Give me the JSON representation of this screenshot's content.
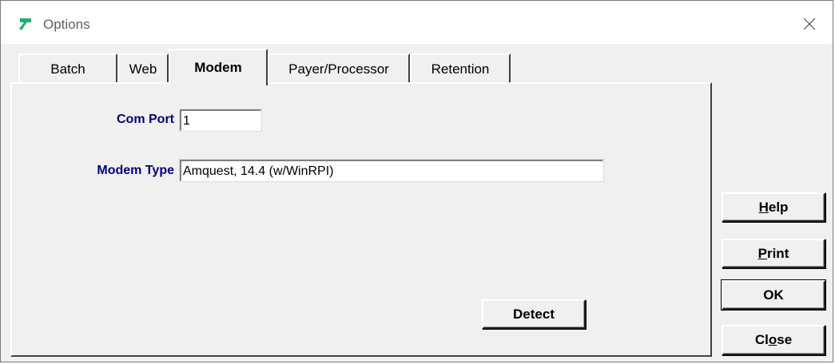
{
  "window": {
    "title": "Options"
  },
  "tabs": [
    {
      "label": "Batch",
      "active": false
    },
    {
      "label": "Web",
      "active": false
    },
    {
      "label": "Modem",
      "active": true
    },
    {
      "label": "Payer/Processor",
      "active": false
    },
    {
      "label": "Retention",
      "active": false
    }
  ],
  "modem": {
    "com_port_label": "Com Port",
    "com_port_value": "1",
    "modem_type_label": "Modem Type",
    "modem_type_value": "Amquest, 14.4 (w/WinRPI)",
    "detect_label": "Detect"
  },
  "buttons": {
    "help": {
      "pre": "",
      "mnemonic": "H",
      "post": "elp"
    },
    "print": {
      "pre": "",
      "mnemonic": "P",
      "post": "rint"
    },
    "ok": {
      "label": "OK"
    },
    "close": {
      "pre": "Cl",
      "mnemonic": "o",
      "post": "se"
    }
  },
  "colors": {
    "accent_icon": "#1fae6e",
    "label_text": "#000080",
    "face": "#f0f0f0"
  }
}
